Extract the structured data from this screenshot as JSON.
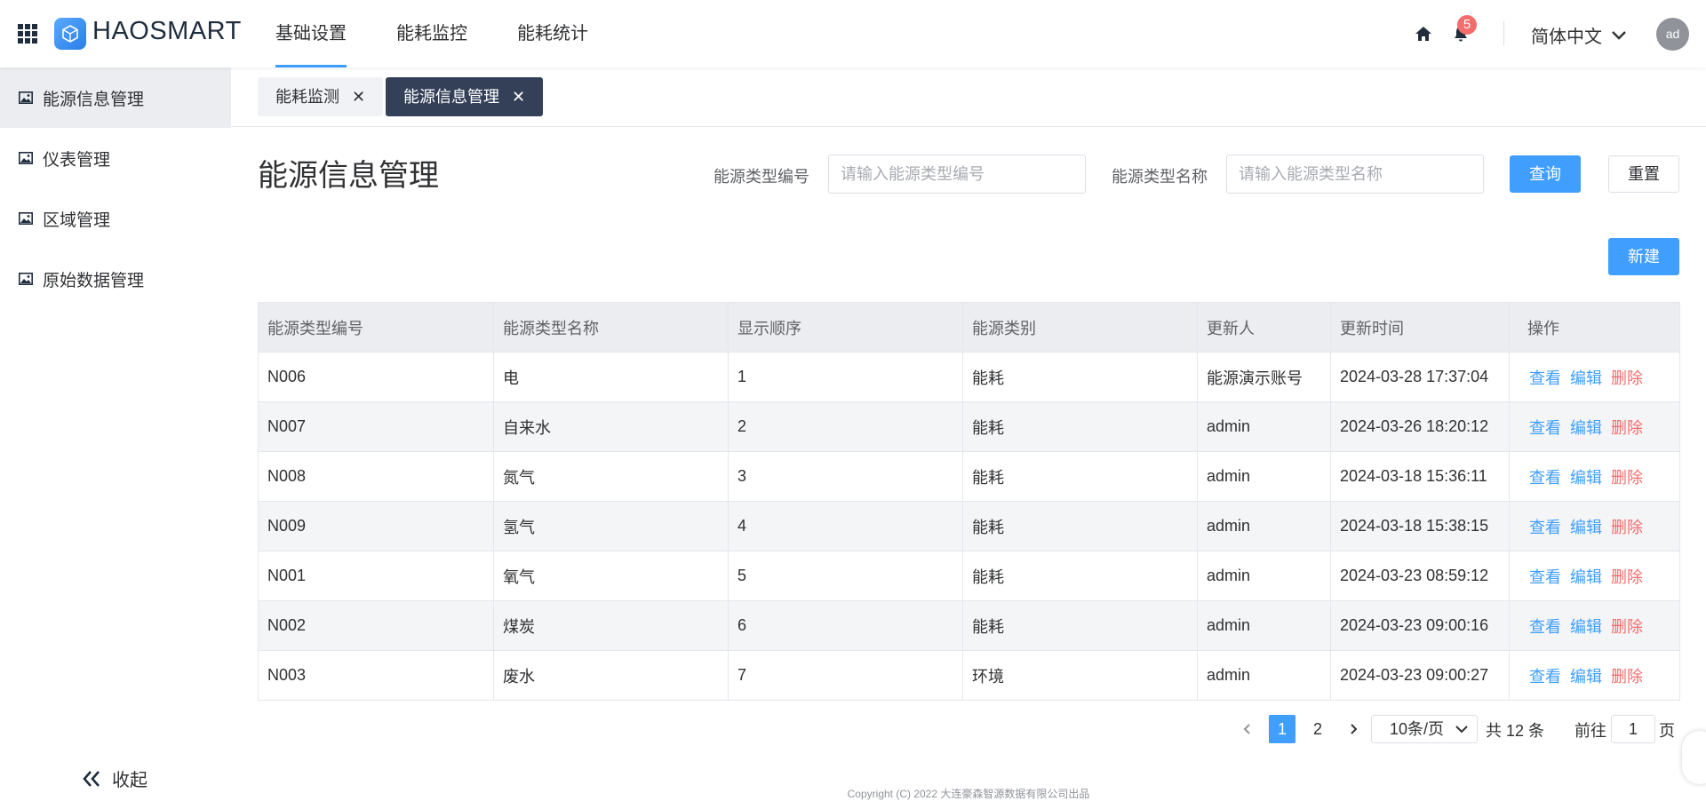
{
  "header": {
    "logo_text": "HAOSMART",
    "nav": [
      "基础设置",
      "能耗监控",
      "能耗统计"
    ],
    "notification_count": "5",
    "language": "简体中文",
    "avatar_text": "ad"
  },
  "sidebar": {
    "items": [
      "能源信息管理",
      "仪表管理",
      "区域管理",
      "原始数据管理"
    ],
    "collapse_label": "收起"
  },
  "tabs": [
    {
      "label": "能耗监测"
    },
    {
      "label": "能源信息管理"
    }
  ],
  "page": {
    "title": "能源信息管理",
    "filters": {
      "code_label": "能源类型编号",
      "code_placeholder": "请输入能源类型编号",
      "name_label": "能源类型名称",
      "name_placeholder": "请输入能源类型名称"
    },
    "query_button": "查询",
    "reset_button": "重置",
    "new_button": "新建"
  },
  "table": {
    "columns": [
      "能源类型编号",
      "能源类型名称",
      "显示顺序",
      "能源类别",
      "更新人",
      "更新时间",
      "操作"
    ],
    "actions": {
      "view": "查看",
      "edit": "编辑",
      "delete": "删除"
    },
    "rows": [
      [
        "N006",
        "电",
        "1",
        "能耗",
        "能源演示账号",
        "2024-03-28 17:37:04"
      ],
      [
        "N007",
        "自来水",
        "2",
        "能耗",
        "admin",
        "2024-03-26 18:20:12"
      ],
      [
        "N008",
        "氮气",
        "3",
        "能耗",
        "admin",
        "2024-03-18 15:36:11"
      ],
      [
        "N009",
        "氢气",
        "4",
        "能耗",
        "admin",
        "2024-03-18 15:38:15"
      ],
      [
        "N001",
        "氧气",
        "5",
        "能耗",
        "admin",
        "2024-03-23 08:59:12"
      ],
      [
        "N002",
        "煤炭",
        "6",
        "能耗",
        "admin",
        "2024-03-23 09:00:16"
      ],
      [
        "N003",
        "废水",
        "7",
        "环境",
        "admin",
        "2024-03-23 09:00:27"
      ]
    ]
  },
  "pagination": {
    "pages": [
      "1",
      "2"
    ],
    "current_page": "1",
    "page_size": "10条/页",
    "total": "共 12 条",
    "goto_prefix": "前往",
    "goto_value": "1",
    "goto_suffix": "页"
  },
  "footer": "Copyright (C) 2022 大连豪森智源数据有限公司出品",
  "colors": {
    "primary": "#409eff",
    "danger": "#f56c6c",
    "active_tab": "#334058"
  }
}
